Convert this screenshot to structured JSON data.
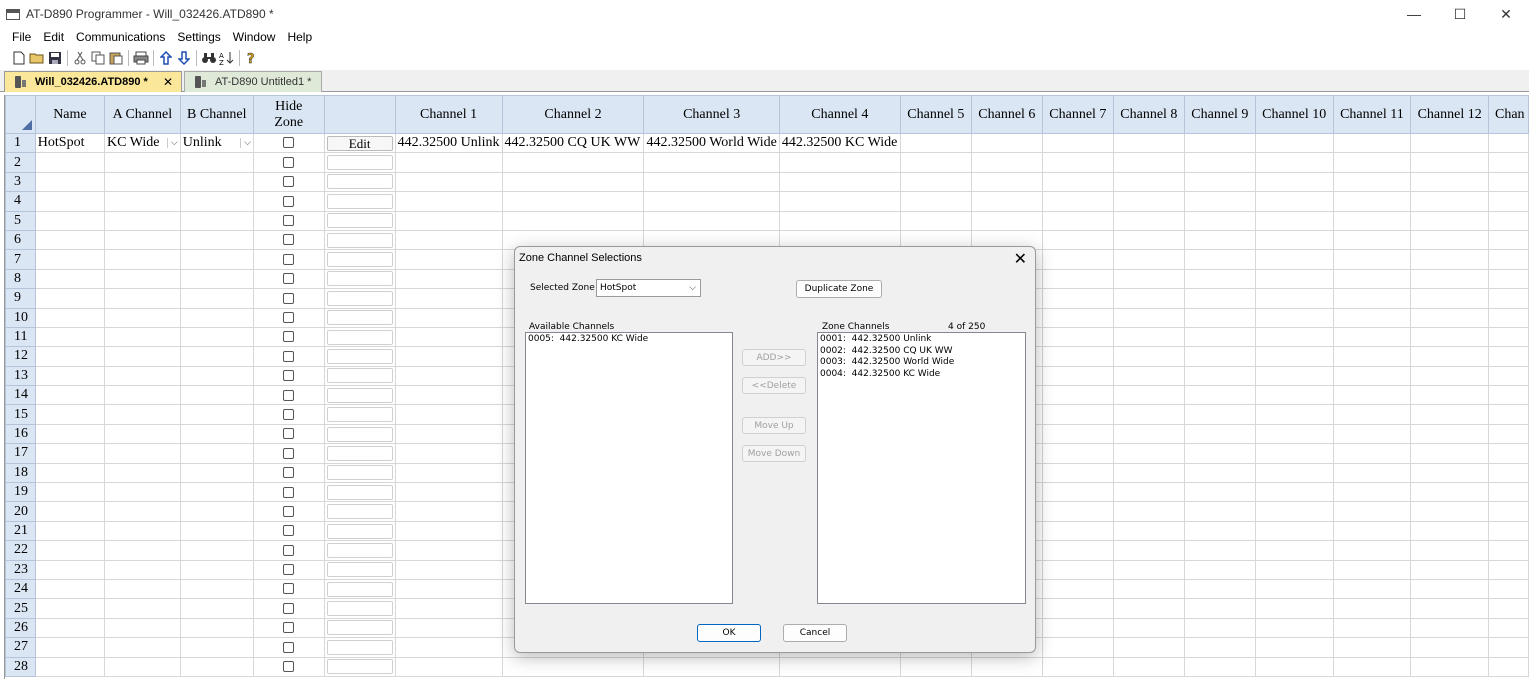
{
  "window": {
    "title": "AT-D890 Programmer - Will_032426.ATD890 *",
    "minimize": "—",
    "maximize": "☐",
    "close": "✕"
  },
  "menu": [
    "File",
    "Edit",
    "Communications",
    "Settings",
    "Window",
    "Help"
  ],
  "toolbar_icons": [
    "new-icon",
    "open-icon",
    "save-icon",
    "cut-icon",
    "copy-icon",
    "paste-icon",
    "print-icon",
    "upload-icon",
    "download-icon",
    "find-icon",
    "sort-icon",
    "help-icon"
  ],
  "tabs": [
    {
      "label": "Will_032426.ATD890 *",
      "close": "✕"
    },
    {
      "label": "AT-D890 Untitled1 *"
    }
  ],
  "grid": {
    "headers": [
      "Name",
      "A Channel",
      "B Channel",
      "Hide Zone",
      "",
      "Channel 1",
      "Channel 2",
      "Channel 3",
      "Channel 4",
      "Channel 5",
      "Channel 6",
      "Channel 7",
      "Channel 8",
      "Channel 9",
      "Channel 10",
      "Channel 11",
      "Channel 12",
      "Chan"
    ],
    "row1": {
      "name": "HotSpot",
      "a_channel": "KC Wide",
      "b_channel": "Unlink",
      "edit": "Edit",
      "channels": [
        "442.32500 Unlink",
        "442.32500 CQ UK WW",
        "442.32500 World Wide",
        "442.32500 KC Wide"
      ]
    },
    "row_numbers": [
      "1",
      "2",
      "3",
      "4",
      "5",
      "6",
      "7",
      "8",
      "9",
      "10",
      "11",
      "12",
      "13",
      "14",
      "15",
      "16",
      "17",
      "18",
      "19",
      "20",
      "21",
      "22",
      "23",
      "24",
      "25",
      "26",
      "27",
      "28"
    ]
  },
  "dialog": {
    "title": "Zone Channel Selections",
    "close": "✕",
    "selected_zone_label": "Selected Zone",
    "selected_zone_value": "HotSpot",
    "duplicate_zone": "Duplicate Zone",
    "available_label": "Available Channels",
    "available": [
      "0005:  442.32500 KC Wide"
    ],
    "zone_label": "Zone Channels",
    "zone_count": "4 of 250",
    "zone_channels": [
      "0001:  442.32500 Unlink",
      "0002:  442.32500 CQ UK WW",
      "0003:  442.32500 World Wide",
      "0004:  442.32500 KC Wide"
    ],
    "add": "ADD>>",
    "delete": "<<Delete",
    "move_up": "Move Up",
    "move_down": "Move Down",
    "ok": "OK",
    "cancel": "Cancel"
  }
}
